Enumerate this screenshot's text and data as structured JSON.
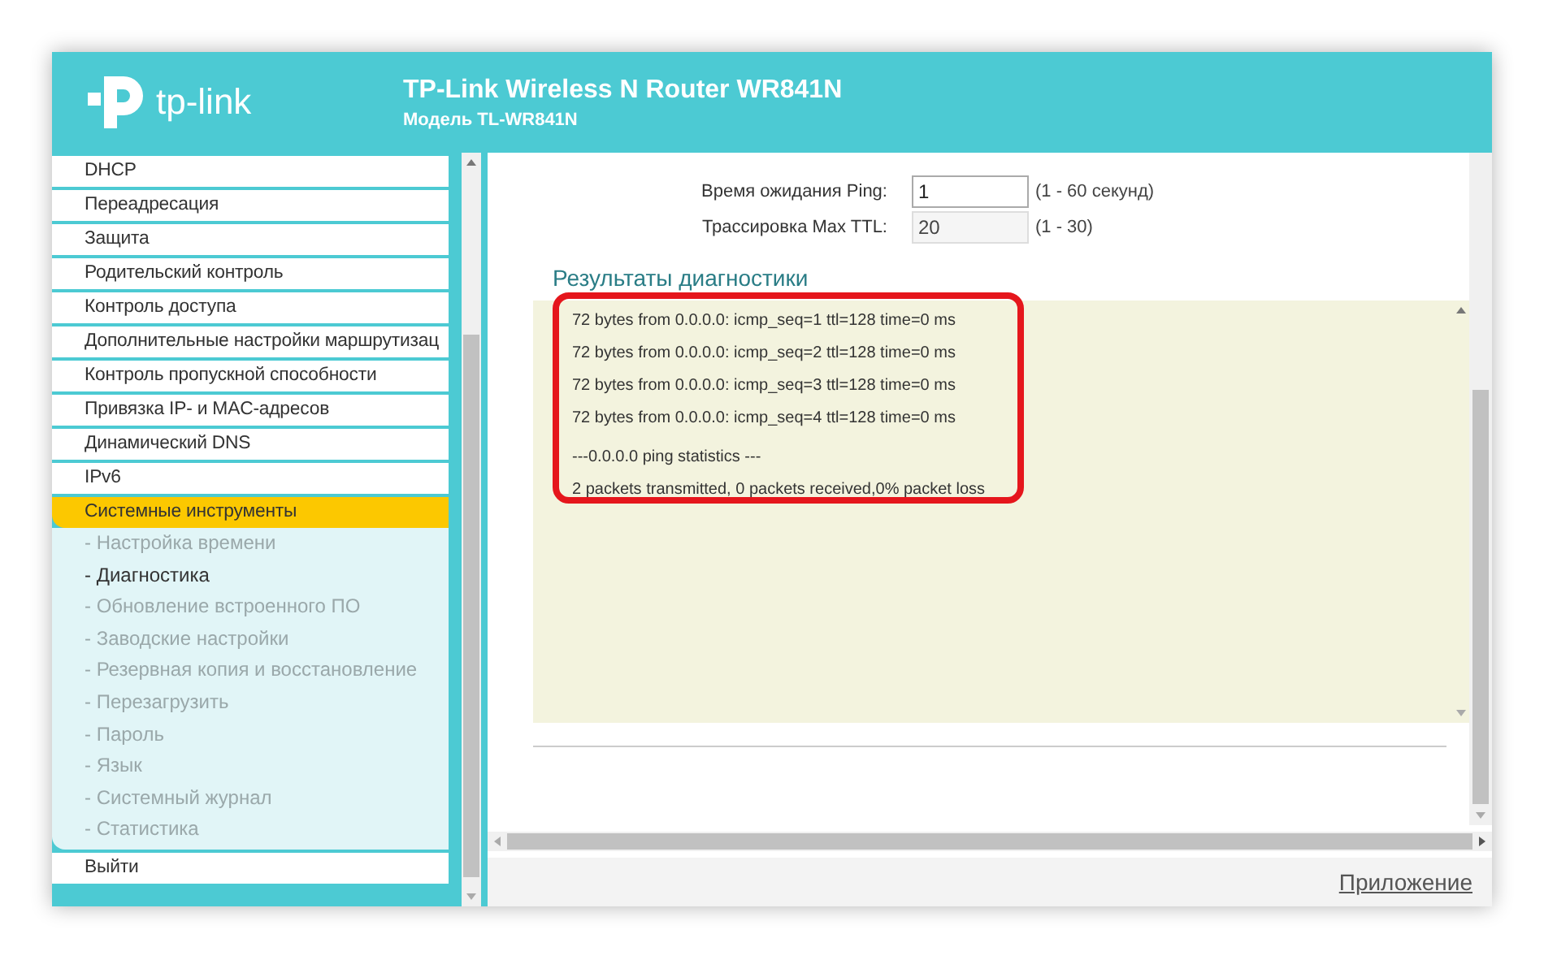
{
  "header": {
    "logo_text": "tp-link",
    "title": "TP-Link Wireless N Router WR841N",
    "model": "Модель TL-WR841N"
  },
  "sidebar": {
    "items": [
      {
        "label": "DHCP",
        "selected": false
      },
      {
        "label": "Переадресация",
        "selected": false
      },
      {
        "label": "Защита",
        "selected": false
      },
      {
        "label": "Родительский контроль",
        "selected": false
      },
      {
        "label": "Контроль доступа",
        "selected": false
      },
      {
        "label": "Дополнительные настройки маршрутизац",
        "selected": false
      },
      {
        "label": "Контроль пропускной способности",
        "selected": false
      },
      {
        "label": "Привязка IP- и MAC-адресов",
        "selected": false
      },
      {
        "label": "Динамический DNS",
        "selected": false
      },
      {
        "label": "IPv6",
        "selected": false
      },
      {
        "label": "Системные инструменты",
        "selected": true,
        "expanded": true,
        "children": [
          {
            "label": "- Настройка времени",
            "selected": false
          },
          {
            "label": "- Диагностика",
            "selected": true
          },
          {
            "label": "- Обновление встроенного ПО",
            "selected": false
          },
          {
            "label": "- Заводские настройки",
            "selected": false
          },
          {
            "label": "- Резервная копия и восстановление",
            "selected": false
          },
          {
            "label": "- Перезагрузить",
            "selected": false
          },
          {
            "label": "- Пароль",
            "selected": false
          },
          {
            "label": "- Язык",
            "selected": false
          },
          {
            "label": "- Системный журнал",
            "selected": false
          },
          {
            "label": "- Статистика",
            "selected": false
          }
        ]
      },
      {
        "label": "Выйти",
        "selected": false
      }
    ]
  },
  "form": {
    "rows": [
      {
        "label": "Время ожидания Ping:",
        "value": "1",
        "hint": "(1 - 60 секунд)",
        "disabled": false
      },
      {
        "label": "Трассировка Max TTL:",
        "value": "20",
        "hint": "(1 - 30)",
        "disabled": true
      }
    ]
  },
  "results": {
    "title": "Результаты диагностики",
    "highlighted": true,
    "replies": [
      "72 bytes from 0.0.0.0: icmp_seq=1 ttl=128 time=0 ms",
      "72 bytes from 0.0.0.0: icmp_seq=2 ttl=128 time=0 ms",
      "72 bytes from 0.0.0.0: icmp_seq=3 ttl=128 time=0 ms",
      "72 bytes from 0.0.0.0: icmp_seq=4 ttl=128 time=0 ms"
    ],
    "statistics": [
      "---0.0.0.0 ping statistics ---",
      "2 packets transmitted, 0 packets received,0% packet loss"
    ]
  },
  "footer": {
    "link": "Приложение"
  }
}
